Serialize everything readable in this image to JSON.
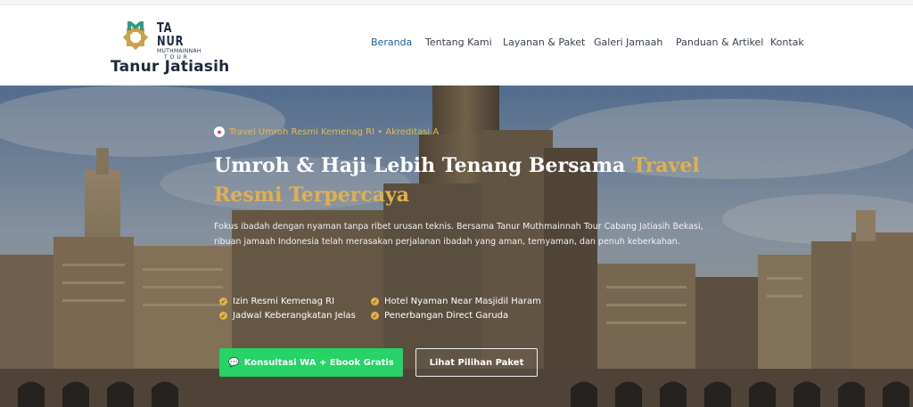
{
  "brand": {
    "logo_main": "TA NUR",
    "logo_sub": "MUTHMAINNAH",
    "logo_tour": "TOUR",
    "site_name": "Tanur Jatiasih",
    "colors": {
      "logo_green": "#2f9a86",
      "logo_gold": "#c9a24a",
      "logo_text": "#1f2a44"
    }
  },
  "nav": {
    "items": [
      {
        "label": "Beranda",
        "active": true
      },
      {
        "label": "Tentang Kami",
        "active": false
      },
      {
        "label": "Layanan & Paket",
        "active": false
      },
      {
        "label": "Galeri Jamaah",
        "active": false
      },
      {
        "label": "Panduan & Artikel",
        "active": false
      },
      {
        "label": "Kontak",
        "active": false
      }
    ],
    "active_color": "#1b5e8a"
  },
  "hero": {
    "badge_icon": "star-icon",
    "badge": "Travel Umroh Resmi Kemenag RI • Akreditasi A",
    "headline_white": "Umroh & Haji Lebih Tenang Bersama ",
    "headline_gold": "Travel Resmi Terpercaya",
    "lead": "Fokus ibadah dengan nyaman tanpa ribet urusan teknis. Bersama Tanur Muthmainnah Tour Cabang Jatiasih Bekasi, ribuan jamaah Indonesia telah merasakan perjalanan ibadah yang aman, ternyaman, dan penuh keberkahan.",
    "features": [
      "Izin Resmi Kemenag RI",
      "Hotel Nyaman Near Masjidil Haram",
      "Jadwal Keberangkatan Jelas",
      "Penerbangan Direct Garuda"
    ],
    "cta_primary": "Konsultasi WA + Ebook Gratis",
    "cta_primary_icon": "chat-icon",
    "cta_secondary": "Lihat Pilihan Paket",
    "colors": {
      "gold": "#e0b04d",
      "whatsapp_green": "#25d366"
    }
  }
}
